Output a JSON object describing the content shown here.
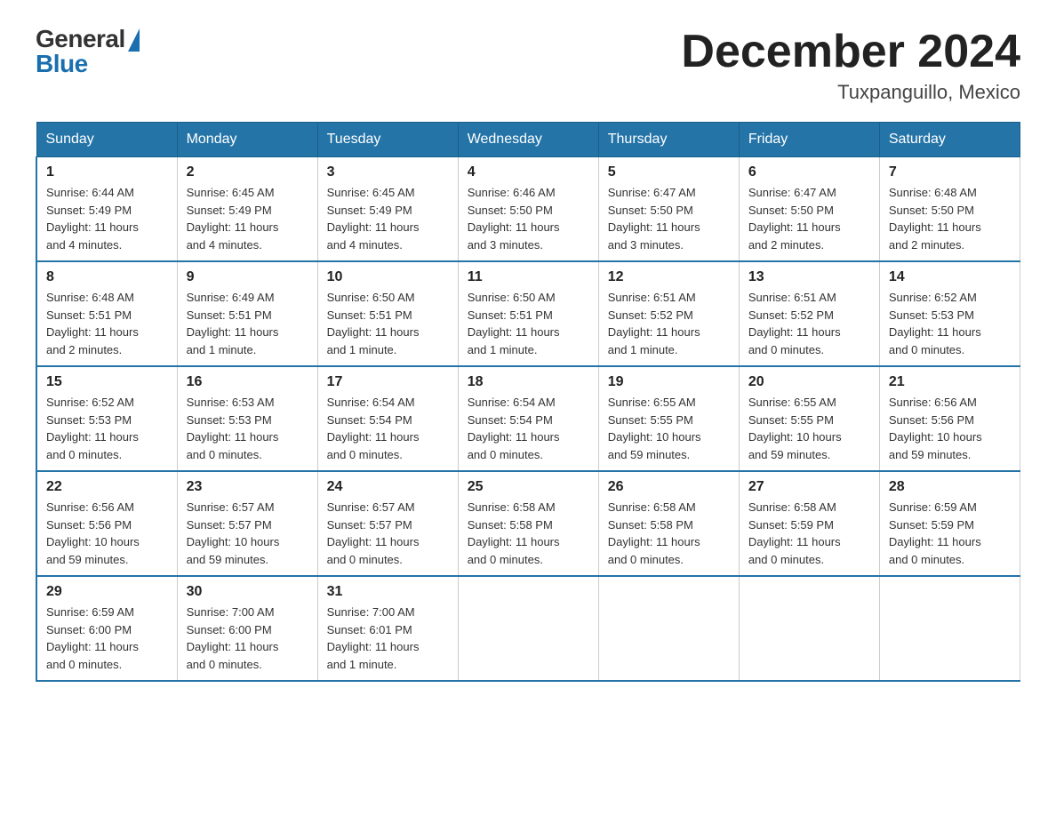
{
  "header": {
    "logo_general": "General",
    "logo_blue": "Blue",
    "month_title": "December 2024",
    "location": "Tuxpanguillo, Mexico"
  },
  "weekdays": [
    "Sunday",
    "Monday",
    "Tuesday",
    "Wednesday",
    "Thursday",
    "Friday",
    "Saturday"
  ],
  "weeks": [
    [
      {
        "day": "1",
        "sunrise": "6:44 AM",
        "sunset": "5:49 PM",
        "daylight": "11 hours and 4 minutes."
      },
      {
        "day": "2",
        "sunrise": "6:45 AM",
        "sunset": "5:49 PM",
        "daylight": "11 hours and 4 minutes."
      },
      {
        "day": "3",
        "sunrise": "6:45 AM",
        "sunset": "5:49 PM",
        "daylight": "11 hours and 4 minutes."
      },
      {
        "day": "4",
        "sunrise": "6:46 AM",
        "sunset": "5:50 PM",
        "daylight": "11 hours and 3 minutes."
      },
      {
        "day": "5",
        "sunrise": "6:47 AM",
        "sunset": "5:50 PM",
        "daylight": "11 hours and 3 minutes."
      },
      {
        "day": "6",
        "sunrise": "6:47 AM",
        "sunset": "5:50 PM",
        "daylight": "11 hours and 2 minutes."
      },
      {
        "day": "7",
        "sunrise": "6:48 AM",
        "sunset": "5:50 PM",
        "daylight": "11 hours and 2 minutes."
      }
    ],
    [
      {
        "day": "8",
        "sunrise": "6:48 AM",
        "sunset": "5:51 PM",
        "daylight": "11 hours and 2 minutes."
      },
      {
        "day": "9",
        "sunrise": "6:49 AM",
        "sunset": "5:51 PM",
        "daylight": "11 hours and 1 minute."
      },
      {
        "day": "10",
        "sunrise": "6:50 AM",
        "sunset": "5:51 PM",
        "daylight": "11 hours and 1 minute."
      },
      {
        "day": "11",
        "sunrise": "6:50 AM",
        "sunset": "5:51 PM",
        "daylight": "11 hours and 1 minute."
      },
      {
        "day": "12",
        "sunrise": "6:51 AM",
        "sunset": "5:52 PM",
        "daylight": "11 hours and 1 minute."
      },
      {
        "day": "13",
        "sunrise": "6:51 AM",
        "sunset": "5:52 PM",
        "daylight": "11 hours and 0 minutes."
      },
      {
        "day": "14",
        "sunrise": "6:52 AM",
        "sunset": "5:53 PM",
        "daylight": "11 hours and 0 minutes."
      }
    ],
    [
      {
        "day": "15",
        "sunrise": "6:52 AM",
        "sunset": "5:53 PM",
        "daylight": "11 hours and 0 minutes."
      },
      {
        "day": "16",
        "sunrise": "6:53 AM",
        "sunset": "5:53 PM",
        "daylight": "11 hours and 0 minutes."
      },
      {
        "day": "17",
        "sunrise": "6:54 AM",
        "sunset": "5:54 PM",
        "daylight": "11 hours and 0 minutes."
      },
      {
        "day": "18",
        "sunrise": "6:54 AM",
        "sunset": "5:54 PM",
        "daylight": "11 hours and 0 minutes."
      },
      {
        "day": "19",
        "sunrise": "6:55 AM",
        "sunset": "5:55 PM",
        "daylight": "10 hours and 59 minutes."
      },
      {
        "day": "20",
        "sunrise": "6:55 AM",
        "sunset": "5:55 PM",
        "daylight": "10 hours and 59 minutes."
      },
      {
        "day": "21",
        "sunrise": "6:56 AM",
        "sunset": "5:56 PM",
        "daylight": "10 hours and 59 minutes."
      }
    ],
    [
      {
        "day": "22",
        "sunrise": "6:56 AM",
        "sunset": "5:56 PM",
        "daylight": "10 hours and 59 minutes."
      },
      {
        "day": "23",
        "sunrise": "6:57 AM",
        "sunset": "5:57 PM",
        "daylight": "10 hours and 59 minutes."
      },
      {
        "day": "24",
        "sunrise": "6:57 AM",
        "sunset": "5:57 PM",
        "daylight": "11 hours and 0 minutes."
      },
      {
        "day": "25",
        "sunrise": "6:58 AM",
        "sunset": "5:58 PM",
        "daylight": "11 hours and 0 minutes."
      },
      {
        "day": "26",
        "sunrise": "6:58 AM",
        "sunset": "5:58 PM",
        "daylight": "11 hours and 0 minutes."
      },
      {
        "day": "27",
        "sunrise": "6:58 AM",
        "sunset": "5:59 PM",
        "daylight": "11 hours and 0 minutes."
      },
      {
        "day": "28",
        "sunrise": "6:59 AM",
        "sunset": "5:59 PM",
        "daylight": "11 hours and 0 minutes."
      }
    ],
    [
      {
        "day": "29",
        "sunrise": "6:59 AM",
        "sunset": "6:00 PM",
        "daylight": "11 hours and 0 minutes."
      },
      {
        "day": "30",
        "sunrise": "7:00 AM",
        "sunset": "6:00 PM",
        "daylight": "11 hours and 0 minutes."
      },
      {
        "day": "31",
        "sunrise": "7:00 AM",
        "sunset": "6:01 PM",
        "daylight": "11 hours and 1 minute."
      },
      null,
      null,
      null,
      null
    ]
  ],
  "labels": {
    "sunrise": "Sunrise:",
    "sunset": "Sunset:",
    "daylight": "Daylight:"
  }
}
